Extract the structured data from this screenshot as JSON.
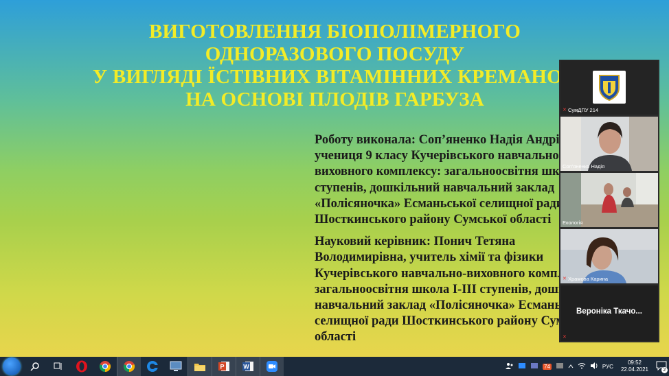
{
  "slide": {
    "title_lines": [
      "ВИГОТОВЛЕННЯ БІОПОЛІМЕРНОГО",
      "ОДНОРАЗОВОГО ПОСУДУ",
      "У ВИГЛЯДІ ЇСТІВНИХ ВІТАМІННИХ КРЕМАНОК",
      "НА ОСНОВІ ПЛОДІВ ГАРБУЗА"
    ],
    "author_lines": [
      "Роботу виконала:  Соп’яненко Надія Андріївна,",
      "учениця  9 класу Кучерівського навчально-",
      "виховного комплексу: загальноосвітня школа І-ІІІ",
      "ступенів, дошкільний навчальний заклад",
      "«Полісяночка» Есманьської селищної ради",
      "Шосткинського району Сумської області"
    ],
    "supervisor_lines": [
      "Науковий керівник: Понич Тетяна",
      "Володимирівна, учитель хімії та фізики",
      "Кучерівського навчально-виховного комплексу:",
      "загальноосвітня школа І-ІІІ ступенів, дошкільний",
      "навчальний заклад «Полісяночка» Есманьської",
      "селищної ради Шосткинського району Сумської",
      "області"
    ]
  },
  "participants": [
    {
      "name": "СумДПУ 214"
    },
    {
      "name": "Соп’яненко Надія"
    },
    {
      "name": "Екологія"
    },
    {
      "name": "Храмова Карина"
    },
    {
      "name": "Вероніка  Ткачо..."
    }
  ],
  "taskbar": {
    "apps": [
      "search-icon",
      "task-view-icon",
      "opera-icon",
      "chrome-icon",
      "chrome-icon",
      "browser-icon",
      "screen-icon",
      "explorer-icon",
      "powerpoint-icon",
      "word-icon",
      "zoom-icon"
    ],
    "tray": {
      "language": "РУС",
      "time": "09:52",
      "date": "22.04.2021",
      "badge": "74",
      "notifications": "2"
    }
  }
}
